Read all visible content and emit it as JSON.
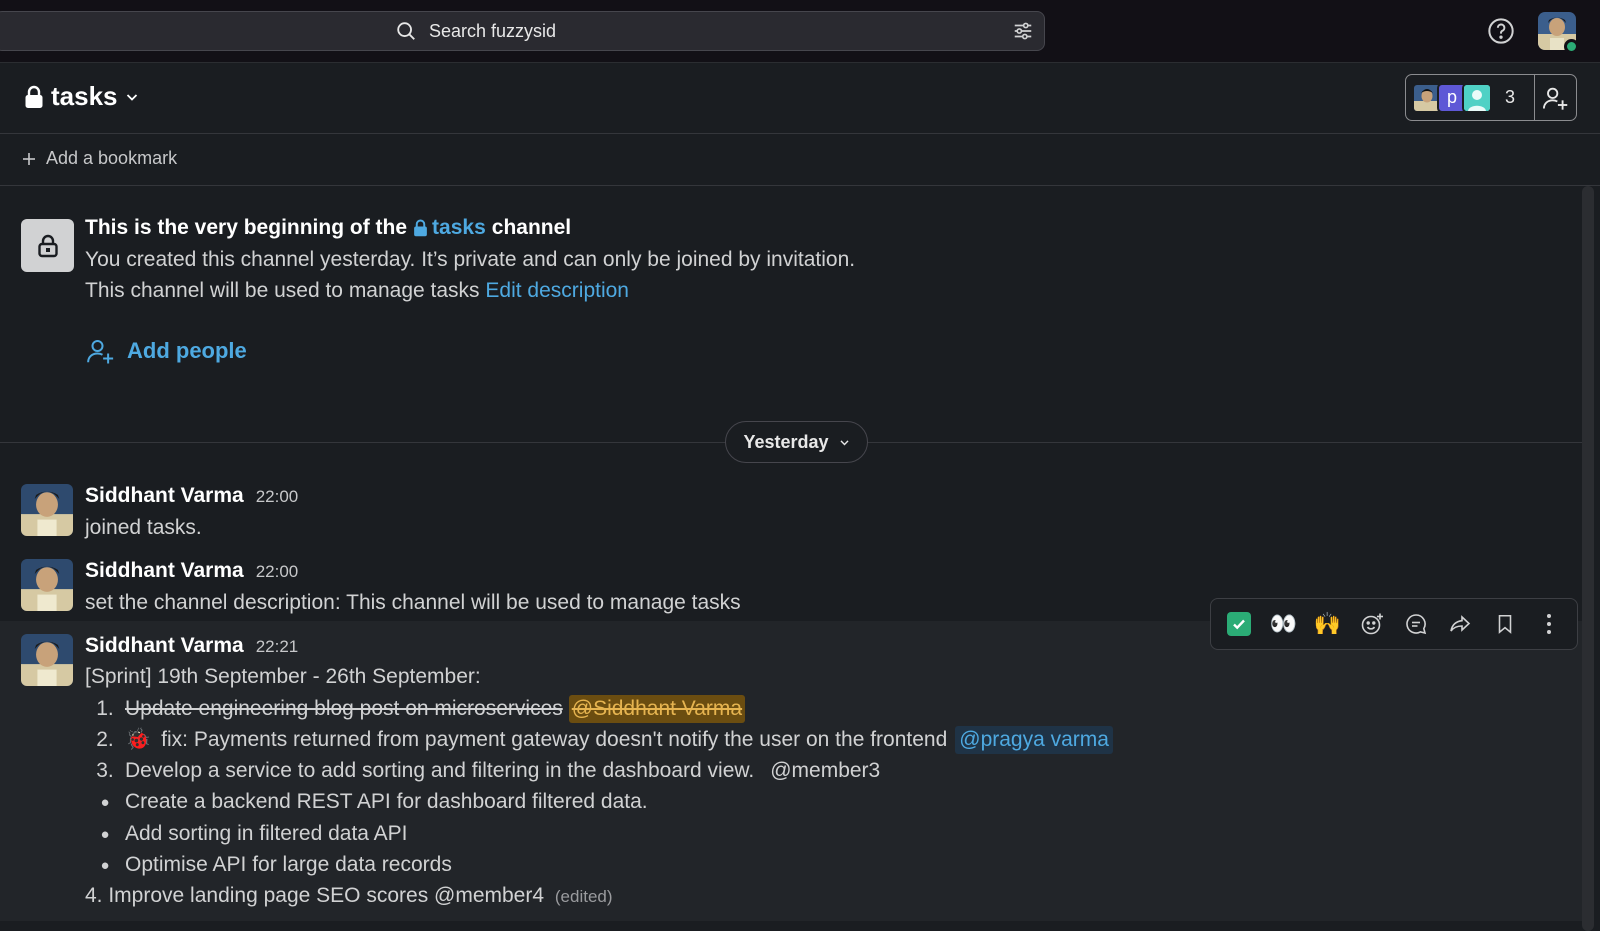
{
  "topbar": {
    "search_placeholder": "Search fuzzysid"
  },
  "channel": {
    "name": "tasks",
    "member_count": "3",
    "member_initial": "p"
  },
  "bookmarks": {
    "add_label": "Add a bookmark"
  },
  "intro": {
    "title_prefix": "This is the very beginning of the",
    "title_channel": "tasks",
    "title_suffix": "channel",
    "line1": "You created this channel yesterday. It’s private and can only be joined by invitation.",
    "line2": "This channel will be used to manage tasks",
    "edit_link": "Edit description",
    "add_people": "Add people"
  },
  "date_divider": {
    "label": "Yesterday"
  },
  "messages": [
    {
      "author": "Siddhant Varma",
      "time": "22:00",
      "text": "joined tasks."
    },
    {
      "author": "Siddhant Varma",
      "time": "22:00",
      "text": "set the channel description: This channel will be used to manage tasks"
    },
    {
      "author": "Siddhant Varma",
      "time": "22:21",
      "text": "[Sprint] 19th September - 26th September:",
      "list": [
        {
          "marker": "1.",
          "text": "Update engineering blog post on microservices ",
          "mention": "@Siddhant Varma"
        },
        {
          "marker": "2.",
          "emoji": "🐞",
          "text": "fix: Payments returned from payment gateway doesn't notify the user on the frontend",
          "mention": "@pragya varma"
        },
        {
          "marker": "3.",
          "text": "Develop a service to add sorting and filtering in the dashboard view.",
          "mention": "@member3"
        },
        {
          "marker": "●",
          "text": "Create a backend REST API for dashboard filtered data."
        },
        {
          "marker": "●",
          "text": "Add sorting in filtered data API"
        },
        {
          "marker": "●",
          "text": "Optimise API for large data records"
        }
      ],
      "footer": "4. Improve landing page SEO scores @member4",
      "edited": "(edited)"
    }
  ],
  "actions": {
    "eyes": "👀",
    "raised_hands": "🙌"
  },
  "colors": {
    "background": "#1a1d21",
    "link": "#4ea9e1",
    "presence": "#2bac76",
    "mention_self_bg": "#6b4d10",
    "mention_self_fg": "#e6b450"
  }
}
